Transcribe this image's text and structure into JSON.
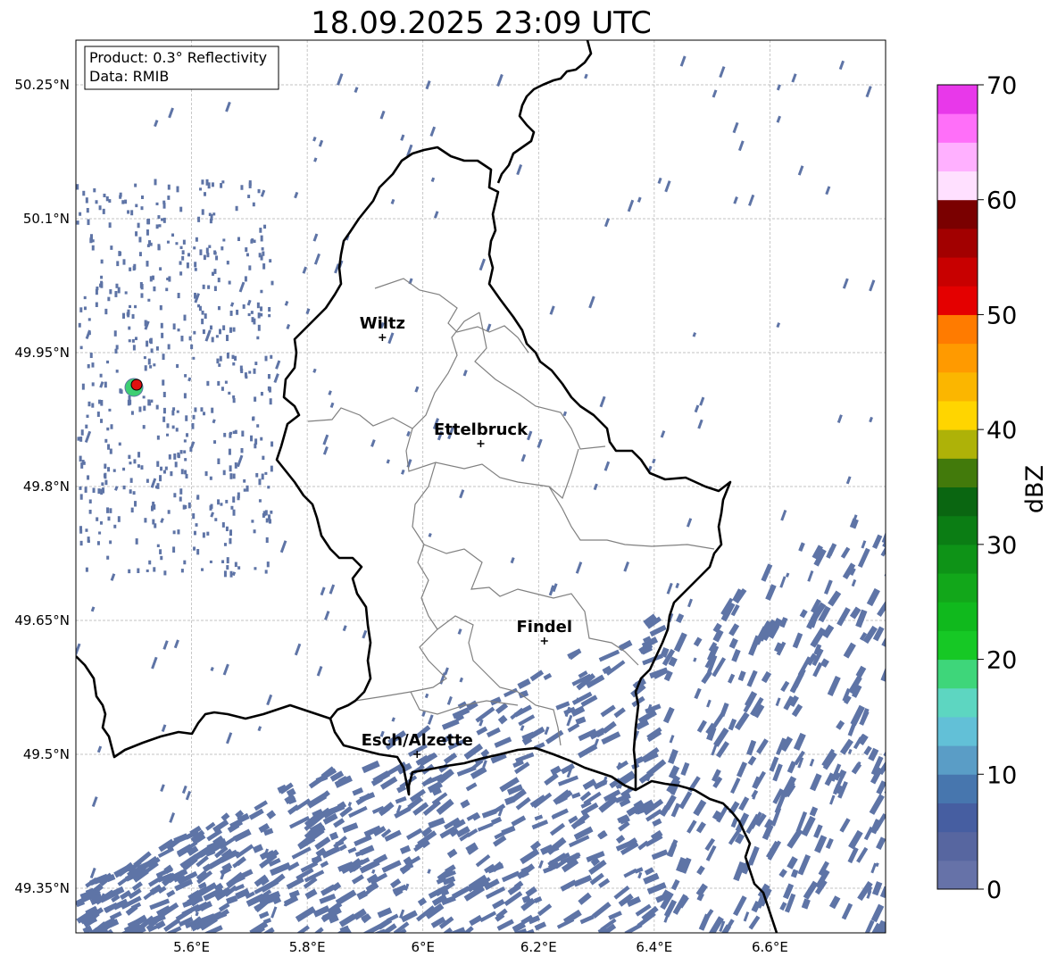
{
  "title": "18.09.2025 23:09 UTC",
  "info_box": {
    "product": "Product: 0.3° Reflectivity",
    "data": "Data: RMIB"
  },
  "map": {
    "lon_range": [
      5.4,
      6.8
    ],
    "lat_range": [
      49.3,
      50.3
    ],
    "lon_ticks": [
      {
        "value": 5.6,
        "label": "5.6°E"
      },
      {
        "value": 5.8,
        "label": "5.8°E"
      },
      {
        "value": 6.0,
        "label": "6°E"
      },
      {
        "value": 6.2,
        "label": "6.2°E"
      },
      {
        "value": 6.4,
        "label": "6.4°E"
      },
      {
        "value": 6.6,
        "label": "6.6°E"
      }
    ],
    "lat_ticks": [
      {
        "value": 50.25,
        "label": "50.25°N"
      },
      {
        "value": 50.1,
        "label": "50.1°N"
      },
      {
        "value": 49.95,
        "label": "49.95°N"
      },
      {
        "value": 49.8,
        "label": "49.8°N"
      },
      {
        "value": 49.65,
        "label": "49.65°N"
      },
      {
        "value": 49.5,
        "label": "49.5°N"
      },
      {
        "value": 49.35,
        "label": "49.35°N"
      }
    ],
    "cities": [
      {
        "name": "Wiltz",
        "lon": 5.93,
        "lat": 49.967
      },
      {
        "name": "Ettelbruck",
        "lon": 6.1,
        "lat": 49.848
      },
      {
        "name": "Findel",
        "lon": 6.21,
        "lat": 49.627
      },
      {
        "name": "Esch/Alzette",
        "lon": 5.99,
        "lat": 49.5
      }
    ],
    "radar_site": {
      "lon": 5.505,
      "lat": 49.914
    },
    "colors": {
      "border": "#000000",
      "cantons": "#808080",
      "echo": "#5e74a6",
      "radar_marker": "#e01010",
      "radar_halo": "#3ecf74"
    }
  },
  "colorbar": {
    "unit": "dBZ",
    "min": 0,
    "max": 70,
    "step": 2.5,
    "tick_labels": [
      "0",
      "10",
      "20",
      "30",
      "40",
      "50",
      "60",
      "70"
    ],
    "colors": [
      "#6672a8",
      "#5766a0",
      "#465ea1",
      "#4776ae",
      "#5a9dc6",
      "#62c0d7",
      "#5dd6c1",
      "#3ed67a",
      "#16c825",
      "#10b91d",
      "#12a71a",
      "#0e9317",
      "#0b7d14",
      "#0a6611",
      "#427a0b",
      "#aeb208",
      "#ffd500",
      "#fbb600",
      "#ff9a00",
      "#ff7b00",
      "#e40000",
      "#c80000",
      "#a20000",
      "#7a0000",
      "#ffe0ff",
      "#ffb0ff",
      "#ff6ff9",
      "#e838ea"
    ]
  }
}
